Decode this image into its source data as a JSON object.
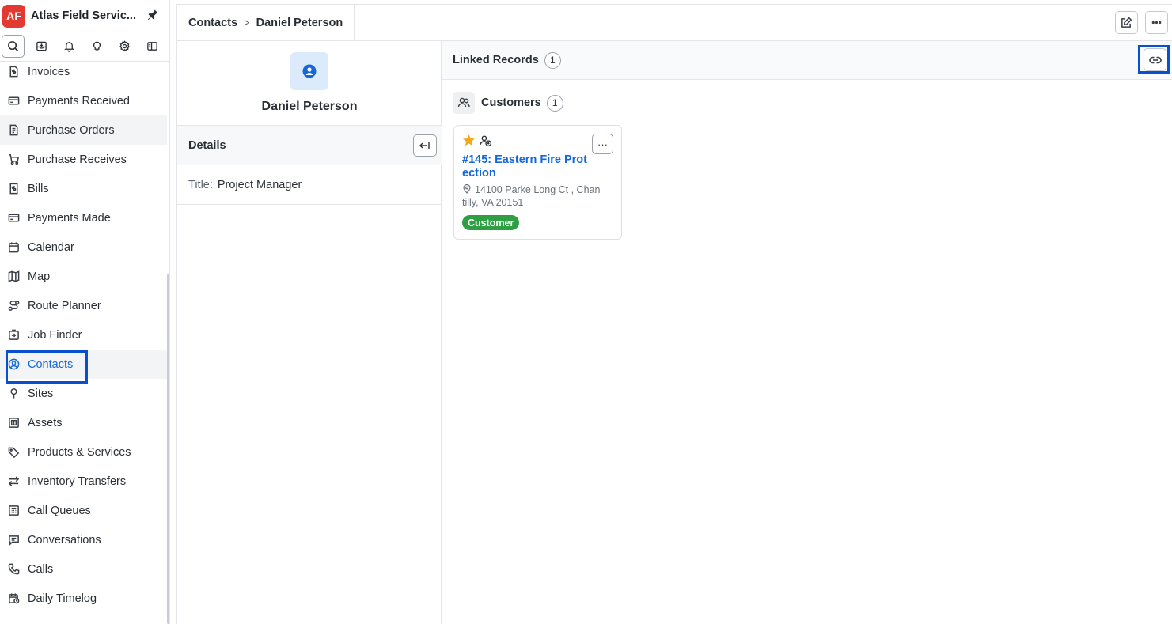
{
  "app": {
    "logo_text": "AF",
    "name": "Atlas Field Servic...",
    "brand_color": "#e23a32"
  },
  "toolbar": {
    "icons": [
      "search-icon",
      "inbox-icon",
      "bell-icon",
      "lightbulb-icon",
      "gear-icon",
      "sidebar-toggle-icon"
    ]
  },
  "sidebar": {
    "items": [
      {
        "label": "Invoices",
        "icon": "invoice-icon"
      },
      {
        "label": "Payments Received",
        "icon": "card-icon"
      },
      {
        "label": "Purchase Orders",
        "icon": "document-icon"
      },
      {
        "label": "Purchase Receives",
        "icon": "cart-icon"
      },
      {
        "label": "Bills",
        "icon": "bill-icon"
      },
      {
        "label": "Payments Made",
        "icon": "card-icon"
      },
      {
        "label": "Calendar",
        "icon": "calendar-icon"
      },
      {
        "label": "Map",
        "icon": "map-icon"
      },
      {
        "label": "Route Planner",
        "icon": "route-icon"
      },
      {
        "label": "Job Finder",
        "icon": "job-finder-icon"
      },
      {
        "label": "Contacts",
        "icon": "contact-icon"
      },
      {
        "label": "Sites",
        "icon": "pin-icon"
      },
      {
        "label": "Assets",
        "icon": "asset-icon"
      },
      {
        "label": "Products & Services",
        "icon": "tag-icon"
      },
      {
        "label": "Inventory Transfers",
        "icon": "transfer-icon"
      },
      {
        "label": "Call Queues",
        "icon": "call-queue-icon"
      },
      {
        "label": "Conversations",
        "icon": "chat-icon"
      },
      {
        "label": "Calls",
        "icon": "phone-icon"
      },
      {
        "label": "Daily Timelog",
        "icon": "timelog-icon"
      }
    ],
    "active": "Contacts"
  },
  "breadcrumb": {
    "parent": "Contacts",
    "separator": ">",
    "current": "Daniel Peterson"
  },
  "contact": {
    "name": "Daniel Peterson",
    "details_title": "Details",
    "title_key": "Title:",
    "title_value": "Project Manager"
  },
  "linked_records": {
    "title": "Linked Records",
    "count": "1",
    "section_title": "Customers",
    "section_count": "1",
    "card": {
      "title": "#145: Eastern Fire Protection",
      "address": "14100 Parke Long Ct , Chantilly, VA 20151",
      "tag": "Customer",
      "more": "···",
      "tag_color": "#2ea043",
      "star_color": "#f0a91c"
    }
  },
  "colors": {
    "accent": "#1468d9",
    "highlight_box": "#0b4fd1"
  }
}
